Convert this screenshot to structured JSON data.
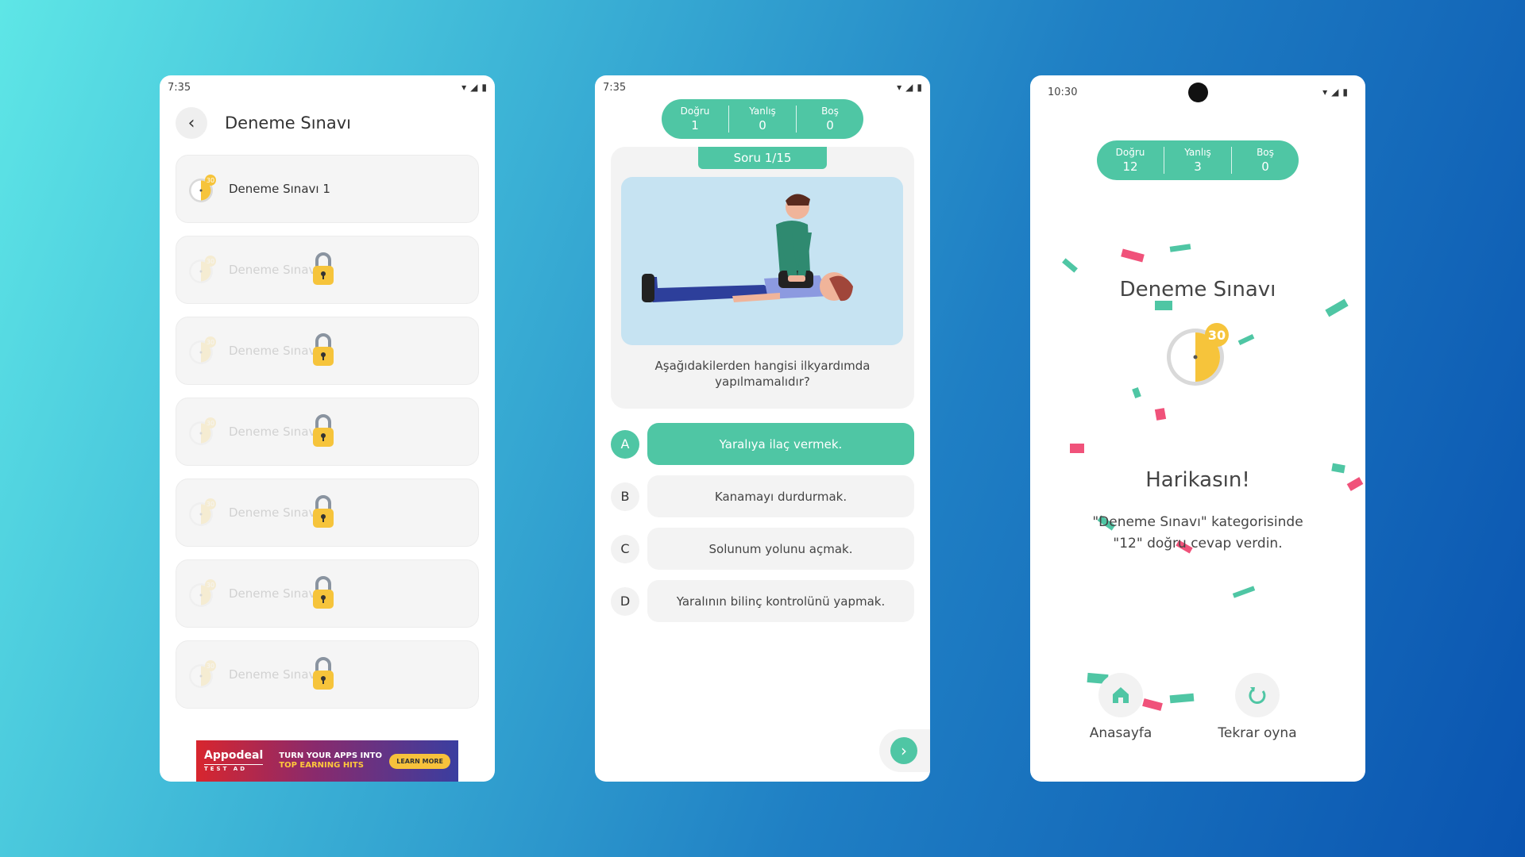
{
  "screen1": {
    "status_time": "7:35",
    "title": "Deneme Sınavı",
    "items": [
      {
        "label": "Deneme Sınavı 1",
        "locked": false
      },
      {
        "label": "Deneme Sınavı",
        "locked": true
      },
      {
        "label": "Deneme Sınavı",
        "locked": true
      },
      {
        "label": "Deneme Sınavı",
        "locked": true
      },
      {
        "label": "Deneme Sınavı",
        "locked": true
      },
      {
        "label": "Deneme Sınavı",
        "locked": true
      },
      {
        "label": "Deneme Sınavı",
        "locked": true
      }
    ],
    "clock_badge": "30",
    "ad": {
      "brand": "Appodeal",
      "brand_tag": "TEST AD",
      "line1": "TURN YOUR APPS INTO",
      "line2": "TOP EARNING HITS",
      "button": "LEARN MORE"
    }
  },
  "screen2": {
    "status_time": "7:35",
    "score": {
      "correct_label": "Doğru",
      "correct": "1",
      "wrong_label": "Yanlış",
      "wrong": "0",
      "empty_label": "Boş",
      "empty": "0"
    },
    "question_tab": "Soru 1/15",
    "question": "Aşağıdakilerden hangisi ilkyardımda yapılmamalıdır?",
    "answers": [
      {
        "letter": "A",
        "text": "Yaralıya ilaç vermek.",
        "selected": true
      },
      {
        "letter": "B",
        "text": "Kanamayı durdurmak.",
        "selected": false
      },
      {
        "letter": "C",
        "text": "Solunum yolunu açmak.",
        "selected": false
      },
      {
        "letter": "D",
        "text": "Yaralının bilinç kontrolünü yapmak.",
        "selected": false
      }
    ]
  },
  "screen3": {
    "status_time": "10:30",
    "score": {
      "correct_label": "Doğru",
      "correct": "12",
      "wrong_label": "Yanlış",
      "wrong": "3",
      "empty_label": "Boş",
      "empty": "0"
    },
    "title": "Deneme Sınavı",
    "clock_badge": "30",
    "congrats": "Harikasın!",
    "message_line1": "\"Deneme Sınavı\" kategorisinde",
    "message_line2": "\"12\" doğru cevap verdin.",
    "home_label": "Anasayfa",
    "replay_label": "Tekrar oyna"
  },
  "colors": {
    "accent": "#4fc6a4",
    "confetti_pink": "#f0527a",
    "clock_yellow": "#f6c43b"
  }
}
